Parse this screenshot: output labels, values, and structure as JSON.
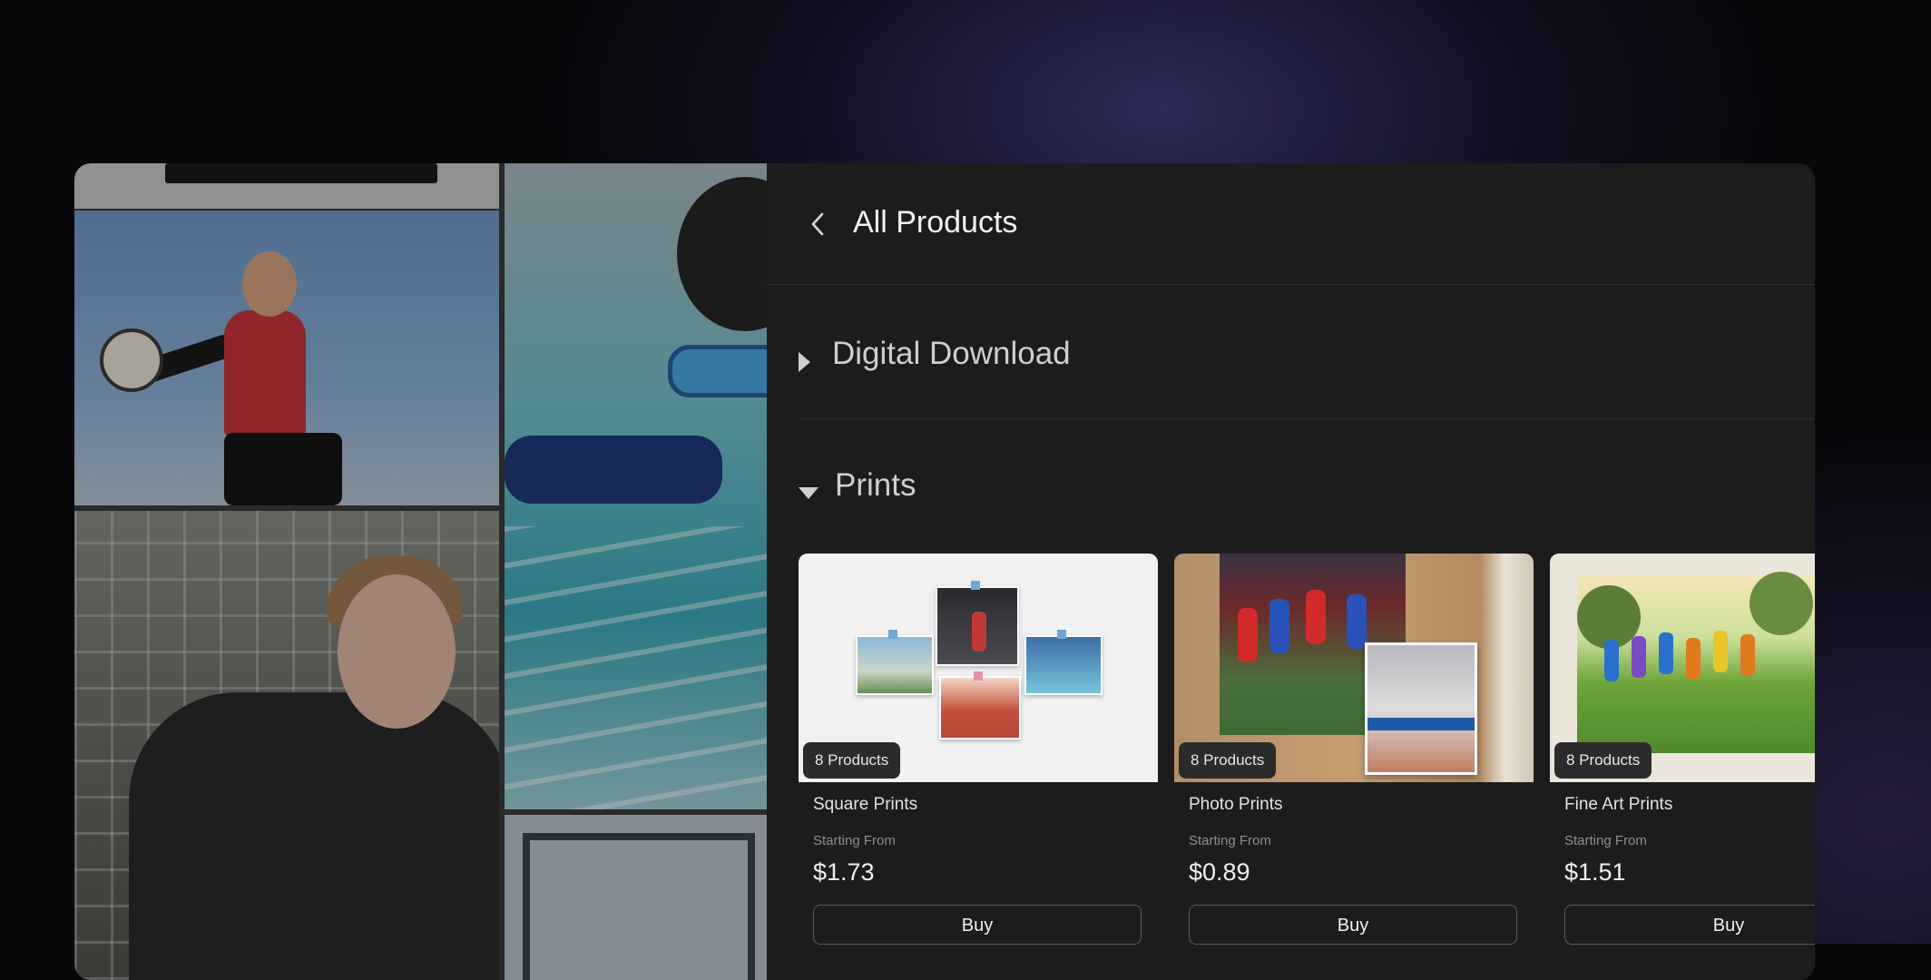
{
  "header": {
    "title": "All Products"
  },
  "sections": {
    "digital_download": {
      "label": "Digital Download",
      "expanded": false
    },
    "prints": {
      "label": "Prints",
      "expanded": true
    }
  },
  "products": [
    {
      "name": "Square Prints",
      "badge": "8 Products",
      "starting_from_label": "Starting From",
      "price": "$1.73",
      "buy_label": "Buy"
    },
    {
      "name": "Photo Prints",
      "badge": "8 Products",
      "starting_from_label": "Starting From",
      "price": "$0.89",
      "buy_label": "Buy"
    },
    {
      "name": "Fine Art Prints",
      "badge": "8 Products",
      "starting_from_label": "Starting From",
      "price": "$1.51",
      "buy_label": "Buy"
    }
  ],
  "icons": {
    "back": "chevron-left-icon",
    "collapsed": "caret-right-icon",
    "expanded": "caret-down-icon"
  },
  "colors": {
    "panel_bg": "#1c1c1d",
    "badge_bg": "#2b2b2c",
    "text_primary": "#f2f2f2",
    "text_muted": "#8f8f8f"
  }
}
